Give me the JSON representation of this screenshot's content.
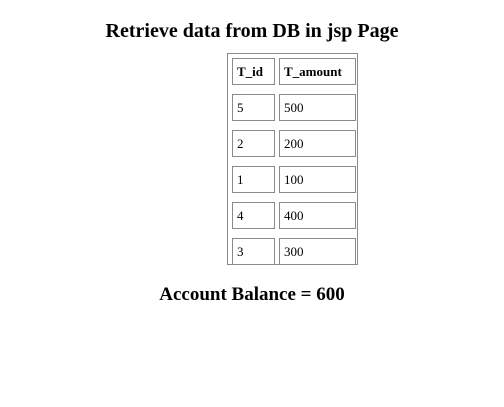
{
  "page": {
    "title": "Retrieve data from DB in jsp Page"
  },
  "table": {
    "headers": {
      "t_id": "T_id",
      "t_amount": "T_amount"
    },
    "rows": [
      {
        "t_id": "5",
        "t_amount": "500"
      },
      {
        "t_id": "2",
        "t_amount": "200"
      },
      {
        "t_id": "1",
        "t_amount": "100"
      },
      {
        "t_id": "4",
        "t_amount": "400"
      },
      {
        "t_id": "3",
        "t_amount": "300"
      }
    ]
  },
  "balance": {
    "text": "Account Balance = 600"
  }
}
